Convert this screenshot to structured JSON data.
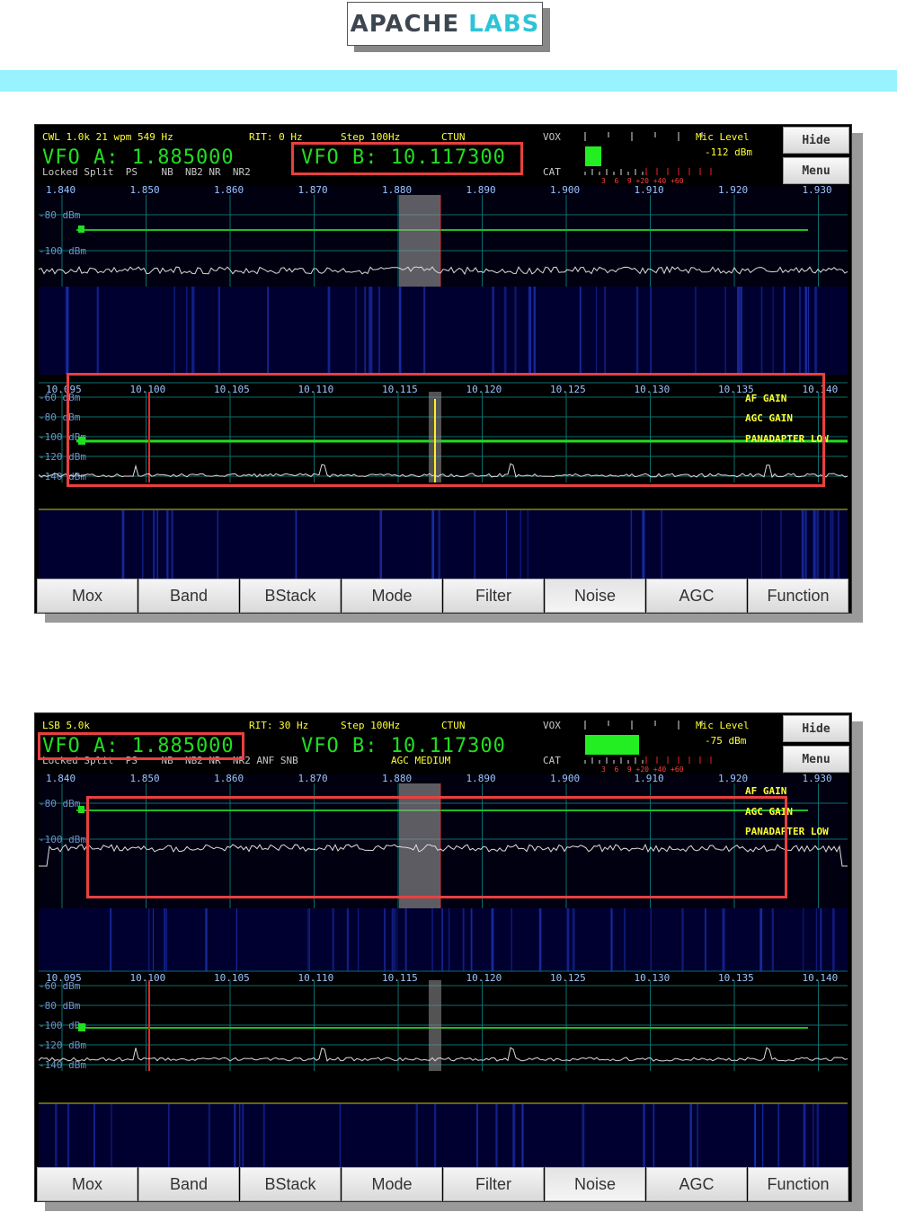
{
  "logo": {
    "word1": "APACHE",
    "word2": "LABS"
  },
  "panels": [
    {
      "mode_line": "CWL 1.0k 21 wpm 549 Hz",
      "rit": "RIT: 0 Hz",
      "step": "Step 100Hz",
      "ctun": "CTUN",
      "vox": "VOX",
      "cat": "CAT",
      "mic_level_label": "Mic Level",
      "dbm": "-112 dBm",
      "vfo_a": "VFO A: 1.885000",
      "vfo_b": "VFO B: 10.117300",
      "status_line": "Locked Split  PS    NB  NB2 NR  NR2",
      "agc_line": "",
      "hide": "Hide",
      "menu": "Menu",
      "meter_scale": "3  6  9 +20 +40 +60",
      "rx1_ticks": [
        "1.840",
        "1.850",
        "1.860",
        "1.870",
        "1.880",
        "1.890",
        "1.900",
        "1.910",
        "1.920",
        "1.930"
      ],
      "rx1_db": [
        "-80 dBm",
        "-100 dBm"
      ],
      "rx2_ticks": [
        "10.095",
        "10.100",
        "10.105",
        "10.110",
        "10.115",
        "10.120",
        "10.125",
        "10.130",
        "10.135",
        "10.140"
      ],
      "rx2_db": [
        "-60 dBm",
        "-80 dBm",
        "-100 dBm",
        "-120 dBm",
        "-140 dBm"
      ],
      "overlay": [
        "AF GAIN",
        "AGC GAIN",
        "PANADAPTER LOW"
      ],
      "buttons": [
        "Mox",
        "Band",
        "BStack",
        "Mode",
        "Filter",
        "Noise",
        "AGC",
        "Function"
      ]
    },
    {
      "mode_line": "LSB 5.0k",
      "rit": "RIT: 30 Hz",
      "step": "Step 100Hz",
      "ctun": "CTUN",
      "vox": "VOX",
      "cat": "CAT",
      "mic_level_label": "Mic Level",
      "dbm": "-75 dBm",
      "vfo_a": "VFO A: 1.885000",
      "vfo_b": "VFO B: 10.117300",
      "status_line": "Locked Split  PS    NB  NB2 NR  NR2 ANF SNB",
      "agc_line": "AGC MEDIUM",
      "hide": "Hide",
      "menu": "Menu",
      "meter_scale": "3  6  9 +20 +40 +60",
      "rx1_ticks": [
        "1.840",
        "1.850",
        "1.860",
        "1.870",
        "1.880",
        "1.890",
        "1.900",
        "1.910",
        "1.920",
        "1.930"
      ],
      "rx1_db": [
        "-80 dBm",
        "-100 dBm"
      ],
      "rx2_ticks": [
        "10.095",
        "10.100",
        "10.105",
        "10.110",
        "10.115",
        "10.120",
        "10.125",
        "10.130",
        "10.135",
        "10.140"
      ],
      "rx2_db": [
        "-60 dBm",
        "-80 dBm",
        "-100 dBm",
        "-120 dBm",
        "-140 dBm"
      ],
      "overlay": [
        "AF GAIN",
        "AGC GAIN",
        "PANADAPTER LOW"
      ],
      "buttons": [
        "Mox",
        "Band",
        "BStack",
        "Mode",
        "Filter",
        "Noise",
        "AGC",
        "Function"
      ]
    }
  ]
}
